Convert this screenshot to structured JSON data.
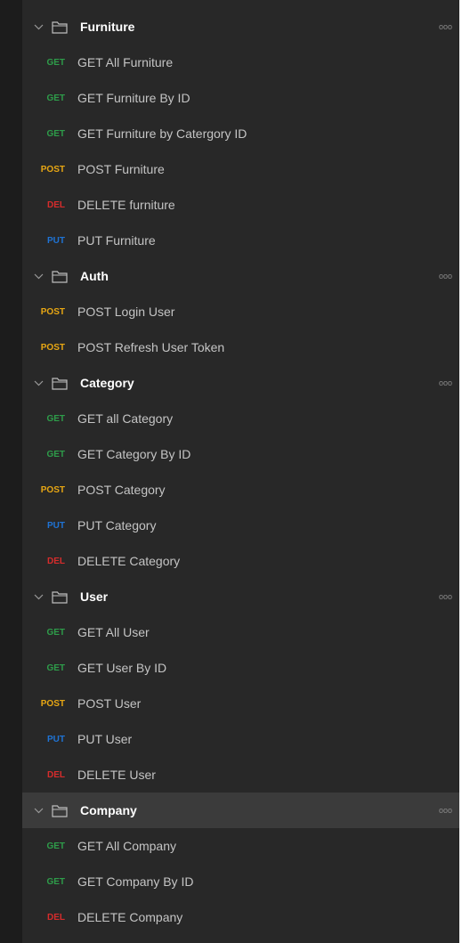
{
  "colors": {
    "GET": "#2e9d4a",
    "POST": "#e8a713",
    "DEL": "#d62c2c",
    "PUT": "#1f74d6"
  },
  "icons": {
    "collapse": "chevron-down-icon",
    "folder": "folder-icon",
    "more": "more-options-icon"
  },
  "more_label": "ooo",
  "folders": [
    {
      "name": "Furniture",
      "requests": [
        {
          "method": "GET",
          "name": "GET All Furniture"
        },
        {
          "method": "GET",
          "name": "GET Furniture By ID"
        },
        {
          "method": "GET",
          "name": "GET Furniture by Catergory ID"
        },
        {
          "method": "POST",
          "name": "POST Furniture"
        },
        {
          "method": "DEL",
          "name": "DELETE furniture"
        },
        {
          "method": "PUT",
          "name": "PUT Furniture"
        }
      ]
    },
    {
      "name": "Auth",
      "requests": [
        {
          "method": "POST",
          "name": "POST Login User"
        },
        {
          "method": "POST",
          "name": "POST Refresh User Token"
        }
      ]
    },
    {
      "name": "Category",
      "requests": [
        {
          "method": "GET",
          "name": "GET all Category"
        },
        {
          "method": "GET",
          "name": "GET Category By ID"
        },
        {
          "method": "POST",
          "name": "POST Category"
        },
        {
          "method": "PUT",
          "name": "PUT Category"
        },
        {
          "method": "DEL",
          "name": "DELETE Category"
        }
      ]
    },
    {
      "name": "User",
      "requests": [
        {
          "method": "GET",
          "name": "GET All User"
        },
        {
          "method": "GET",
          "name": "GET User By ID"
        },
        {
          "method": "POST",
          "name": "POST User"
        },
        {
          "method": "PUT",
          "name": "PUT User"
        },
        {
          "method": "DEL",
          "name": "DELETE User"
        }
      ]
    },
    {
      "name": "Company",
      "selected": true,
      "requests": [
        {
          "method": "GET",
          "name": "GET All Company"
        },
        {
          "method": "GET",
          "name": "GET Company By ID"
        },
        {
          "method": "DEL",
          "name": "DELETE Company"
        }
      ]
    }
  ]
}
